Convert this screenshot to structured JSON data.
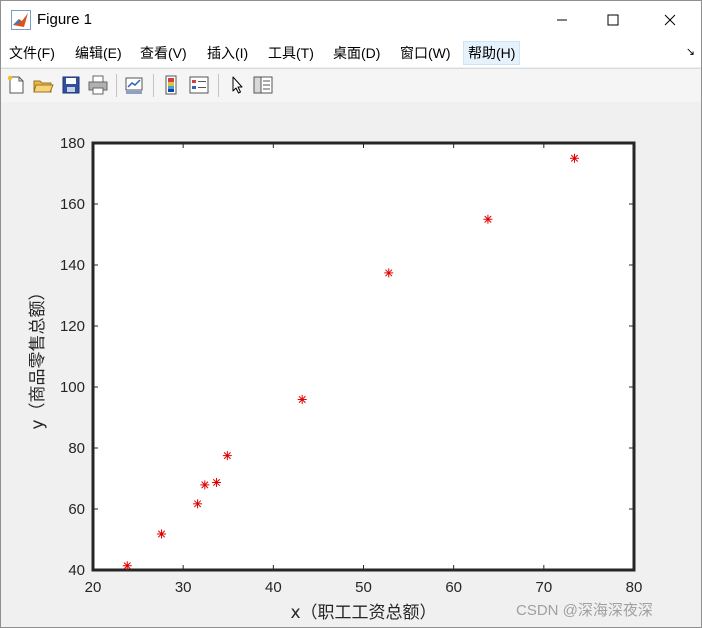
{
  "window": {
    "title": "Figure 1",
    "minimize_glyph": "—",
    "maximize_glyph": "☐",
    "close_glyph": "✕"
  },
  "menu": {
    "items": [
      {
        "label": "文件(F)"
      },
      {
        "label": "编辑(E)"
      },
      {
        "label": "查看(V)"
      },
      {
        "label": "插入(I)"
      },
      {
        "label": "工具(T)"
      },
      {
        "label": "桌面(D)"
      },
      {
        "label": "窗口(W)"
      },
      {
        "label": "帮助(H)",
        "active": true
      }
    ],
    "corner_glyph": "↘"
  },
  "toolbar": {
    "icons": [
      "new-figure-icon",
      "open-file-icon",
      "save-icon",
      "print-icon",
      "link-plot-icon",
      "insert-colorbar-icon",
      "insert-legend-icon",
      "pointer-icon",
      "property-inspector-icon"
    ]
  },
  "chart_data": {
    "type": "scatter",
    "title": "",
    "xlabel": "x（职工工资总额）",
    "ylabel": "y（商品零售总额）",
    "xlim": [
      20,
      80
    ],
    "ylim": [
      40,
      180
    ],
    "xticks": [
      20,
      30,
      40,
      50,
      60,
      70,
      80
    ],
    "yticks": [
      40,
      60,
      80,
      100,
      120,
      140,
      160,
      180
    ],
    "marker": "*",
    "marker_color": "#e00000",
    "grid": false,
    "series": [
      {
        "x": [
          23.8,
          27.6,
          31.6,
          32.4,
          33.7,
          34.9,
          43.2,
          52.8,
          63.8,
          73.4
        ],
        "y": [
          41.4,
          51.8,
          61.7,
          67.9,
          68.7,
          77.5,
          95.9,
          137.4,
          155.0,
          175.0
        ]
      }
    ]
  },
  "watermark": "CSDN @深海深夜深"
}
